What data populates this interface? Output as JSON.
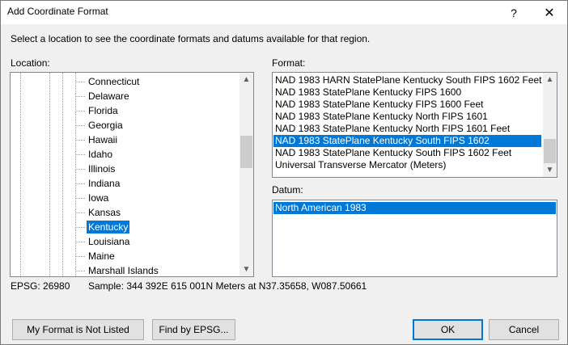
{
  "dialog": {
    "title": "Add Coordinate Format",
    "help_glyph": "?",
    "close_glyph": "✕",
    "instructions": "Select a location to see the coordinate formats and datums available for that region."
  },
  "location": {
    "label": "Location:",
    "items": [
      {
        "label": "Connecticut",
        "selected": false
      },
      {
        "label": "Delaware",
        "selected": false
      },
      {
        "label": "Florida",
        "selected": false
      },
      {
        "label": "Georgia",
        "selected": false
      },
      {
        "label": "Hawaii",
        "selected": false
      },
      {
        "label": "Idaho",
        "selected": false
      },
      {
        "label": "Illinois",
        "selected": false
      },
      {
        "label": "Indiana",
        "selected": false
      },
      {
        "label": "Iowa",
        "selected": false
      },
      {
        "label": "Kansas",
        "selected": false
      },
      {
        "label": "Kentucky",
        "selected": true
      },
      {
        "label": "Louisiana",
        "selected": false
      },
      {
        "label": "Maine",
        "selected": false
      },
      {
        "label": "Marshall Islands",
        "selected": false
      }
    ]
  },
  "format": {
    "label": "Format:",
    "items": [
      {
        "label": "NAD 1983 HARN StatePlane Kentucky South FIPS 1602 Feet",
        "selected": false
      },
      {
        "label": "NAD 1983 StatePlane Kentucky FIPS 1600",
        "selected": false
      },
      {
        "label": "NAD 1983 StatePlane Kentucky FIPS 1600 Feet",
        "selected": false
      },
      {
        "label": "NAD 1983 StatePlane Kentucky North FIPS 1601",
        "selected": false
      },
      {
        "label": "NAD 1983 StatePlane Kentucky North FIPS 1601 Feet",
        "selected": false
      },
      {
        "label": "NAD 1983 StatePlane Kentucky South FIPS 1602",
        "selected": true
      },
      {
        "label": "NAD 1983 StatePlane Kentucky South FIPS 1602 Feet",
        "selected": false
      },
      {
        "label": "Universal Transverse Mercator (Meters)",
        "selected": false
      }
    ]
  },
  "datum": {
    "label": "Datum:",
    "items": [
      {
        "label": "North American 1983",
        "selected": true
      }
    ]
  },
  "info": {
    "epsg": "EPSG: 26980",
    "sample": "Sample: 344 392E  615 001N Meters at N37.35658, W087.50661"
  },
  "buttons": {
    "not_listed": "My Format is Not Listed",
    "find_epsg": "Find by EPSG...",
    "ok": "OK",
    "cancel": "Cancel"
  },
  "icons": {
    "scroll_up": "chevron-up-icon",
    "scroll_down": "chevron-down-icon"
  },
  "colors": {
    "selection": "#0078d7",
    "dialog_bg": "#f0f0f0"
  }
}
